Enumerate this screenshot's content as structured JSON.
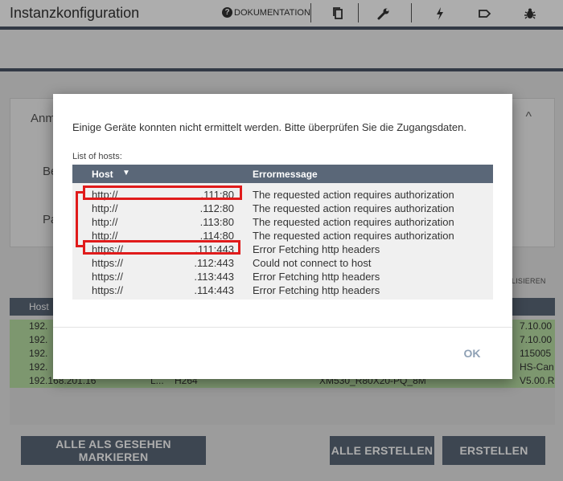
{
  "app": {
    "title": "Instanzkonfiguration",
    "doc_label": "DOKUMENTATION",
    "doc_icon_glyph": "?",
    "toolbar_icons": [
      "copy-icon",
      "wrench-icon",
      "lightning-icon",
      "tag-icon",
      "bug-icon"
    ]
  },
  "panel": {
    "heading_partial": "Anm",
    "field1_partial": "Be",
    "field2_partial": "Pa",
    "chevron": "^"
  },
  "right_hint_partial": "LISIEREN",
  "bg_table": {
    "header_host": "Host",
    "rows": [
      {
        "c1": "192.",
        "c2": "",
        "c3": "",
        "c4": "",
        "c5": "7.10.00"
      },
      {
        "c1": "192.",
        "c2": "",
        "c3": "",
        "c4": "",
        "c5": "7.10.00"
      },
      {
        "c1": "192.",
        "c2": "",
        "c3": "",
        "c4": "",
        "c5": "115005"
      },
      {
        "c1": "192.",
        "c2": "",
        "c3": "",
        "c4": "",
        "c5": "HS-Can"
      },
      {
        "c1": "192.168.201.16",
        "c2": "L...",
        "c3": "H264",
        "c4": "XM530_R80X20-PQ_8M",
        "c5": "V5.00.R"
      }
    ]
  },
  "buttons": {
    "mark_all_seen": "ALLE ALS GESEHEN MARKIEREN",
    "create_all": "ALLE ERSTELLEN",
    "create": "ERSTELLEN"
  },
  "dialog": {
    "message": "Einige Geräte konnten nicht ermittelt werden. Bitte überprüfen Sie die Zugangsdaten.",
    "list_label": "List of hosts:",
    "col_host": "Host",
    "sort_glyph": "▼",
    "col_error": "Errormessage",
    "rows": [
      {
        "proto": "http://",
        "ip": ".111:80",
        "error": "The requested action requires authorization"
      },
      {
        "proto": "http://",
        "ip": ".112:80",
        "error": "The requested action requires authorization"
      },
      {
        "proto": "http://",
        "ip": ".113:80",
        "error": "The requested action requires authorization"
      },
      {
        "proto": "http://",
        "ip": ".114:80",
        "error": "The requested action requires authorization"
      },
      {
        "proto": "https://",
        "ip": ".111:443",
        "error": "Error Fetching http headers"
      },
      {
        "proto": "https://",
        "ip": ".112:443",
        "error": "Could not connect to host"
      },
      {
        "proto": "https://",
        "ip": ".113:443",
        "error": "Error Fetching http headers"
      },
      {
        "proto": "https://",
        "ip": ".114:443",
        "error": "Error Fetching http headers"
      }
    ],
    "ok_label": "OK"
  },
  "colors": {
    "header_bg": "#5a6778",
    "row_success": "#b8dfa4",
    "annotation_red": "#e01b1b",
    "ok_text": "#8fa1b5"
  }
}
